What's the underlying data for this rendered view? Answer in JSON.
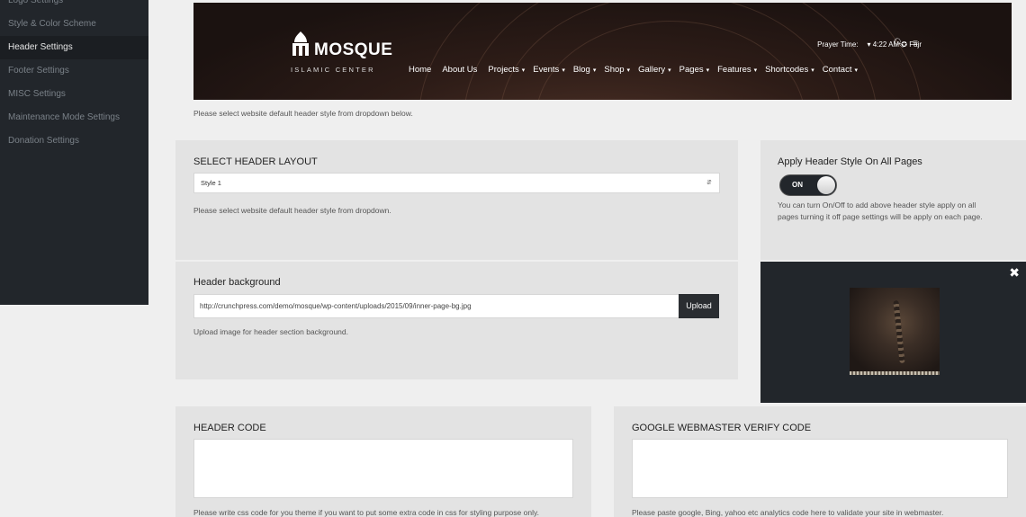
{
  "sidebar": {
    "items": [
      {
        "label": "Logo Settings"
      },
      {
        "label": "Style & Color Scheme"
      },
      {
        "label": "Header Settings"
      },
      {
        "label": "Footer Settings"
      },
      {
        "label": "MISC Settings"
      },
      {
        "label": "Maintenance Mode Settings"
      },
      {
        "label": "Donation Settings"
      }
    ],
    "active": "Header Settings"
  },
  "preview": {
    "logo_title": "MOSQUE",
    "logo_subtitle": "ISLAMIC CENTER",
    "prayer_label": "Prayer Time:",
    "prayer_value": "▾ 4:22 AM ✪ Fajr",
    "nav": [
      {
        "label": "Home",
        "caret": ""
      },
      {
        "label": "About Us",
        "caret": ""
      },
      {
        "label": "Projects",
        "caret": "▾"
      },
      {
        "label": "Events",
        "caret": "▾"
      },
      {
        "label": "Blog",
        "caret": "▾"
      },
      {
        "label": "Shop",
        "caret": "▾"
      },
      {
        "label": "Gallery",
        "caret": "▾"
      },
      {
        "label": "Pages",
        "caret": "▾"
      },
      {
        "label": "Features",
        "caret": "▾"
      },
      {
        "label": "Shortcodes",
        "caret": "▾"
      },
      {
        "label": "Contact",
        "caret": "▾"
      }
    ],
    "icons": [
      "search-icon",
      "menu-icon"
    ]
  },
  "header_style_help": "Please select website default header style from dropdown below.",
  "layout": {
    "title": "SELECT HEADER LAYOUT",
    "selected": "Style 1",
    "help": "Please select website default header style from dropdown."
  },
  "apply_all": {
    "title": "Apply Header Style On All Pages",
    "toggle_label": "ON",
    "help_line1": "You can turn On/Off to add above header style apply on all",
    "help_line2": "pages turning it off page settings will be apply on each page."
  },
  "background": {
    "title": "Header background",
    "url": "http://crunchpress.com/demo/mosque/wp-content/uploads/2015/09/inner-page-bg.jpg",
    "upload_label": "Upload",
    "help": "Upload image for header section background."
  },
  "header_code": {
    "title": "HEADER CODE",
    "help": "Please write css code for you theme if you want to put some extra code in css for styling purpose only."
  },
  "webmaster": {
    "title": "GOOGLE WEBMASTER VERIFY CODE",
    "help": "Please paste google, Bing, yahoo etc analytics code here to validate your site in webmaster."
  },
  "colors": {
    "sidebar_bg": "#22262b",
    "panel_bg": "#e3e3e3",
    "page_bg": "#efefef"
  }
}
